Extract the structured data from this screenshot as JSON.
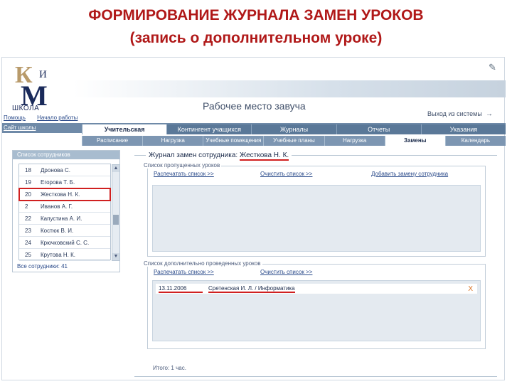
{
  "slide": {
    "title_line1": "ФОРМИРОВАНИЕ ЖУРНАЛА ЗАМЕН УРОКОВ",
    "title_line2": "(запись о дополнительном уроке)"
  },
  "header": {
    "logo_letters": "К",
    "logo_i": "И",
    "logo_m": "М",
    "logo_school": "ШКОЛА",
    "workspace_title": "Рабочее место завуча",
    "logout": "Выход из системы",
    "help": "Помощь",
    "schedule": "Начало работы",
    "nav_school": "Сайт школы"
  },
  "tabs_main": [
    {
      "label": "Учительская",
      "active": true
    },
    {
      "label": "Контингент учащихся",
      "active": false
    },
    {
      "label": "Журналы",
      "active": false
    },
    {
      "label": "Отчеты",
      "active": false
    },
    {
      "label": "Указания",
      "active": false
    }
  ],
  "tabs_sub": [
    {
      "label": "Расписание",
      "active": false
    },
    {
      "label": "Нагрузка",
      "active": false
    },
    {
      "label": "Учебные помещения",
      "active": false
    },
    {
      "label": "Учебные планы",
      "active": false
    },
    {
      "label": "Нагрузка",
      "active": false
    },
    {
      "label": "Замены",
      "active": true
    },
    {
      "label": "Календарь",
      "active": false
    }
  ],
  "staff_panel": {
    "header": "Список сотрудников",
    "rows": [
      {
        "n": "18",
        "name": "Дронова С."
      },
      {
        "n": "19",
        "name": "Егорова Т. Б."
      },
      {
        "n": "20",
        "name": "Жесткова Н. К.",
        "selected": true
      },
      {
        "n": "2",
        "name": "Иванов А. Г."
      },
      {
        "n": "22",
        "name": "Капустина А. И."
      },
      {
        "n": "23",
        "name": "Костюк В. И."
      },
      {
        "n": "24",
        "name": "Крючковский С. С."
      },
      {
        "n": "25",
        "name": "Крутова Н. К."
      }
    ],
    "footer": "Все сотрудники: 41"
  },
  "journal": {
    "title_prefix": "Журнал замен сотрудника:",
    "employee": "Жесткова Н. К.",
    "missed_section": {
      "title": "Список пропущенных уроков",
      "links": [
        "Распечатать список >>",
        "Очистить список >>",
        "Добавить замену сотрудника"
      ]
    },
    "extra_section": {
      "title": "Список дополнительно проведенных уроков",
      "links": [
        "Распечатать список >>",
        "Очистить список >>"
      ],
      "entry": {
        "date": "13.11.2006",
        "text": "Сретенская И. Л. / Информатика",
        "delete": "Х"
      }
    },
    "total": "Итого: 1 час."
  }
}
